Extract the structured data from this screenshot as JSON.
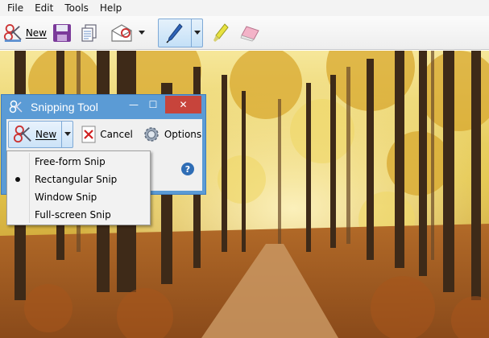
{
  "menu": [
    "File",
    "Edit",
    "Tools",
    "Help"
  ],
  "toolbar": {
    "new_label": "New",
    "icons": [
      "new-snip-icon",
      "save-icon",
      "copy-icon",
      "send-email-icon",
      "dropdown-arrow-icon",
      "pen-icon",
      "highlighter-icon",
      "eraser-icon"
    ]
  },
  "snipping_tool": {
    "title": "Snipping Tool",
    "new_label": "New",
    "cancel_label": "Cancel",
    "options_label": "Options",
    "help_glyph": "?",
    "close_glyph": "✕",
    "maximize_glyph": "☐",
    "minimize_glyph": "—"
  },
  "snip_modes": {
    "items": [
      "Free-form Snip",
      "Rectangular Snip",
      "Window Snip",
      "Full-screen Snip"
    ],
    "selected": "Rectangular Snip"
  },
  "colors": {
    "window_frame": "#5b9bd5",
    "close_button": "#c7443b",
    "selected_tool": "#c4e0f7"
  }
}
